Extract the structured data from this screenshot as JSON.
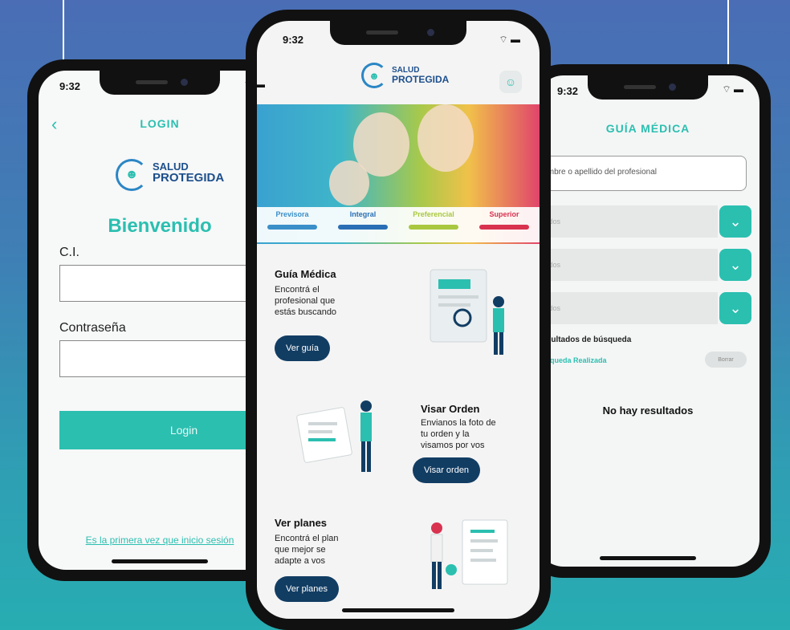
{
  "phones": {
    "left": {
      "status_time": "9:32",
      "title": "LOGIN",
      "logo": {
        "line1": "SALUD",
        "line2": "PROTEGIDA"
      },
      "welcome": "Bienvenido",
      "ci_label": "C.I.",
      "password_label": "Contraseña",
      "login_button": "Login",
      "first_time_link": "Es la primera vez que inicio sesión"
    },
    "center": {
      "status_time": "9:32",
      "logo": {
        "line1": "SALUD",
        "line2": "PROTEGIDA"
      },
      "plans": [
        {
          "name": "Previsora",
          "color": "#3a8fc9"
        },
        {
          "name": "Integral",
          "color": "#2a6fb5"
        },
        {
          "name": "Preferencial",
          "color": "#a9c83f"
        },
        {
          "name": "Superior",
          "color": "#d8324f"
        }
      ],
      "guia": {
        "title": "Guía Médica",
        "desc": "Encontrá el profesional que estás buscando",
        "button": "Ver guía"
      },
      "orden": {
        "title": "Visar Orden",
        "desc": "Envianos la foto de tu orden y la visamos por vos",
        "button": "Visar orden"
      },
      "planes": {
        "title": "Ver planes",
        "desc": "Encontrá el plan que mejor se adapte a vos",
        "button": "Ver planes"
      }
    },
    "right": {
      "status_time": "9:32",
      "title": "GUÍA MÉDICA",
      "search_placeholder": "Nombre o apellido del profesional",
      "dropdowns": [
        "Todos",
        "Todos",
        "Todos"
      ],
      "results_title": "Resultados de búsqueda",
      "search_status": "Búsqueda Realizada",
      "clear_button": "Borrar",
      "no_results": "No hay resultados"
    }
  },
  "colors": {
    "accent": "#2bbfb0",
    "navy": "#123d63",
    "brand_blue": "#1d4f8c"
  }
}
